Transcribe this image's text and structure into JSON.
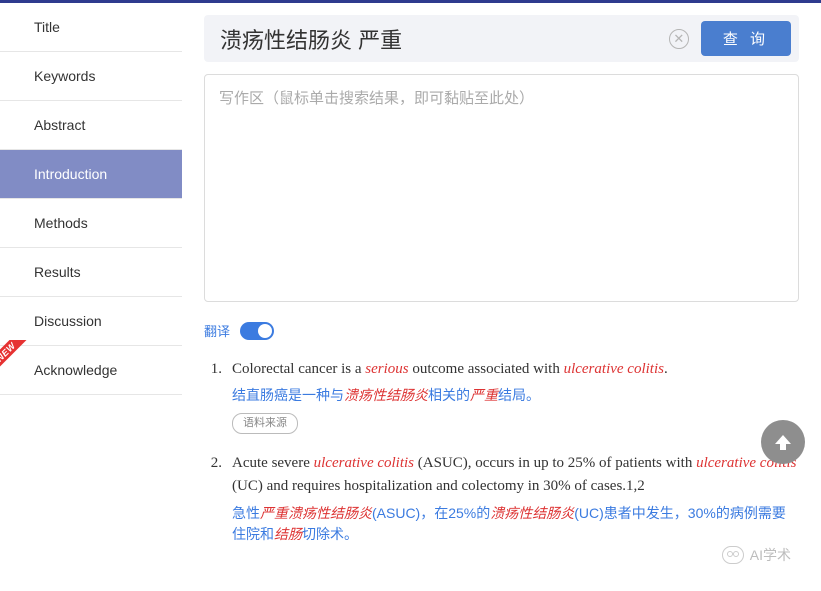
{
  "sidebar": {
    "items": [
      {
        "label": "Title"
      },
      {
        "label": "Keywords"
      },
      {
        "label": "Abstract"
      },
      {
        "label": "Introduction",
        "active": true
      },
      {
        "label": "Methods"
      },
      {
        "label": "Results"
      },
      {
        "label": "Discussion"
      },
      {
        "label": "Acknowledge",
        "badge": "NEW"
      }
    ]
  },
  "search": {
    "query": "溃疡性结肠炎 严重",
    "query_button": "查 询"
  },
  "writebox": {
    "placeholder": "写作区（鼠标单击搜索结果，即可黏贴至此处）"
  },
  "translate": {
    "label": "翻译",
    "on": true
  },
  "results": [
    {
      "num": "1.",
      "en_parts": [
        {
          "t": "Colorectal cancer is a ",
          "hl": false
        },
        {
          "t": "serious",
          "hl": true
        },
        {
          "t": " outcome associated with ",
          "hl": false
        },
        {
          "t": "ulcerative colitis",
          "hl": true
        },
        {
          "t": ".",
          "hl": false
        }
      ],
      "zh_parts": [
        {
          "t": "结直肠癌是一种与",
          "hl": false
        },
        {
          "t": "溃疡性结肠炎",
          "hl": true
        },
        {
          "t": "相关的",
          "hl": false
        },
        {
          "t": "严重",
          "hl": true
        },
        {
          "t": "结局。",
          "hl": false
        }
      ],
      "source_btn": "语料来源"
    },
    {
      "num": "2.",
      "en_parts": [
        {
          "t": "Acute severe ",
          "hl": false
        },
        {
          "t": "ulcerative colitis",
          "hl": true
        },
        {
          "t": " (ASUC), occurs in up to 25% of patients with ",
          "hl": false
        },
        {
          "t": "ulcerative colitis",
          "hl": true
        },
        {
          "t": " (UC) and requires hospitalization and colectomy in 30% of cases.1,2",
          "hl": false
        }
      ],
      "zh_parts": [
        {
          "t": "急性",
          "hl": false
        },
        {
          "t": "严重溃疡性结肠炎",
          "hl": true
        },
        {
          "t": "(ASUC)，在25%的",
          "hl": false
        },
        {
          "t": "溃疡性结肠炎",
          "hl": true
        },
        {
          "t": "(UC)患者中发生，30%的病例需要住院和",
          "hl": false
        },
        {
          "t": "结肠",
          "hl": true
        },
        {
          "t": "切除术。",
          "hl": false
        }
      ]
    }
  ],
  "watermark": "AI学术"
}
